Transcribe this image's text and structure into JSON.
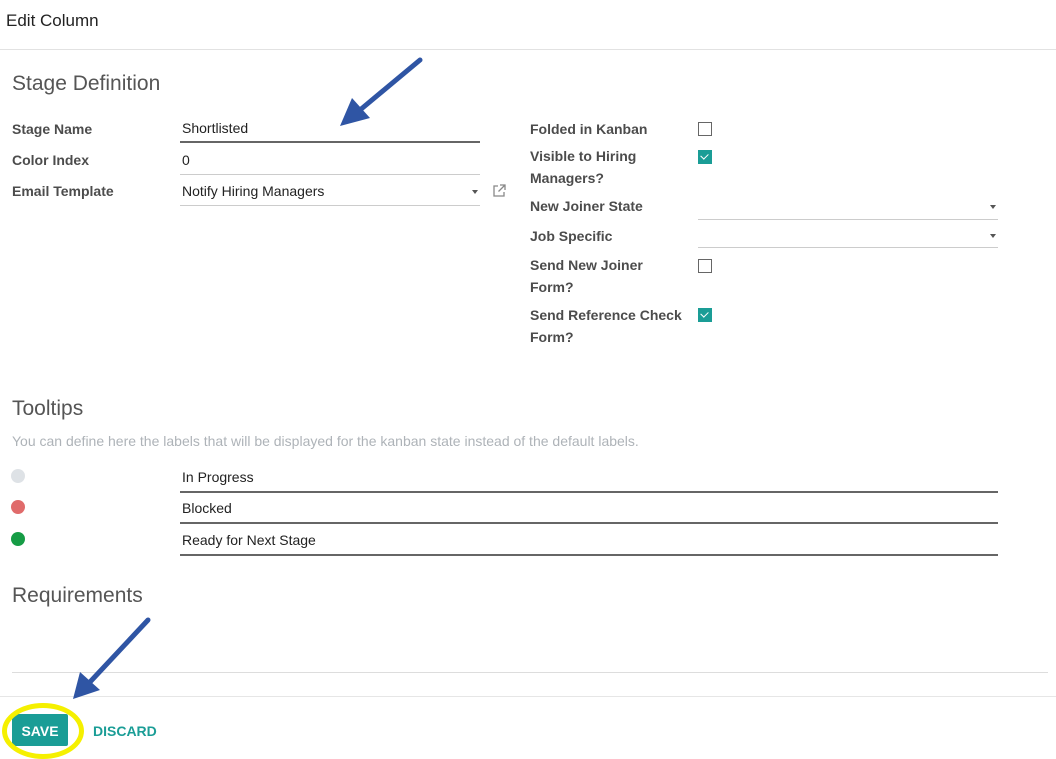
{
  "dialog": {
    "title": "Edit Column"
  },
  "stage_definition": {
    "title": "Stage Definition",
    "left_fields": [
      {
        "label": "Stage Name",
        "value": "Shortlisted"
      },
      {
        "label": "Color Index",
        "value": "0"
      },
      {
        "label": "Email Template",
        "value": "Notify Hiring Managers"
      }
    ],
    "right_fields": {
      "folded_in_kanban": {
        "label": "Folded in Kanban",
        "checked": false
      },
      "visible_to_hiring_managers": {
        "label_line1": "Visible to Hiring",
        "label_line2": "Managers?",
        "checked": true
      },
      "new_joiner_state": {
        "label": "New Joiner State",
        "value": ""
      },
      "job_specific": {
        "label": "Job Specific",
        "value": ""
      },
      "send_new_joiner_form": {
        "label_line1": "Send New Joiner",
        "label_line2": "Form?",
        "checked": false
      },
      "send_reference_check_form": {
        "label_line1": "Send Reference Check",
        "label_line2": "Form?",
        "checked": true
      }
    }
  },
  "tooltips": {
    "title": "Tooltips",
    "hint": "You can define here the labels that will be displayed for the kanban state instead of the default labels.",
    "items": [
      {
        "state": "normal",
        "color": "#dee2e6",
        "label": "In Progress"
      },
      {
        "state": "blocked",
        "color": "#e06b6b",
        "label": "Blocked"
      },
      {
        "state": "done",
        "color": "#169c45",
        "label": "Ready for Next Stage"
      }
    ]
  },
  "requirements": {
    "title": "Requirements",
    "value": ""
  },
  "footer": {
    "save_label": "SAVE",
    "discard_label": "DISCARD"
  },
  "colors": {
    "accent": "#1a9d96",
    "annotation_arrow": "#2f55a4",
    "annotation_highlight": "#f5f000"
  }
}
